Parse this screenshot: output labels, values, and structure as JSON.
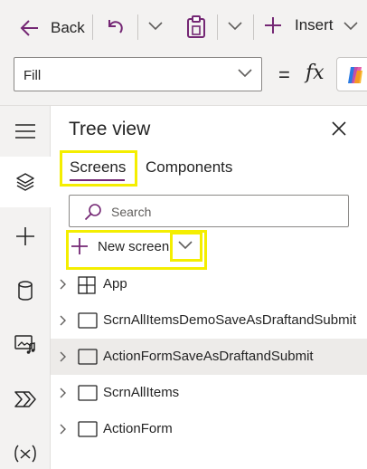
{
  "toolbar": {
    "back_label": "Back",
    "insert_label": "Insert"
  },
  "formula_bar": {
    "property": "Fill",
    "equals": "=",
    "fx": "fx"
  },
  "tree_view": {
    "title": "Tree view",
    "tabs": [
      {
        "label": "Screens",
        "active": true
      },
      {
        "label": "Components",
        "active": false
      }
    ],
    "search_placeholder": "Search",
    "new_screen_label": "New screen",
    "items": [
      {
        "label": "App",
        "icon": "app-icon",
        "selected": false
      },
      {
        "label": "ScrnAllItemsDemoSaveAsDraftandSubmit",
        "icon": "screen-icon",
        "selected": false
      },
      {
        "label": "ActionFormSaveAsDraftandSubmit",
        "icon": "screen-icon",
        "selected": true
      },
      {
        "label": "ScrnAllItems",
        "icon": "screen-icon",
        "selected": false
      },
      {
        "label": "ActionForm",
        "icon": "screen-icon",
        "selected": false
      }
    ]
  },
  "rail": [
    "menu-icon",
    "layers-icon",
    "add-icon",
    "data-icon",
    "media-icon",
    "power-automate-icon",
    "variables-icon"
  ],
  "colors": {
    "accent": "#742774",
    "highlight": "#f4ee00",
    "selected_row": "#edebe9"
  }
}
